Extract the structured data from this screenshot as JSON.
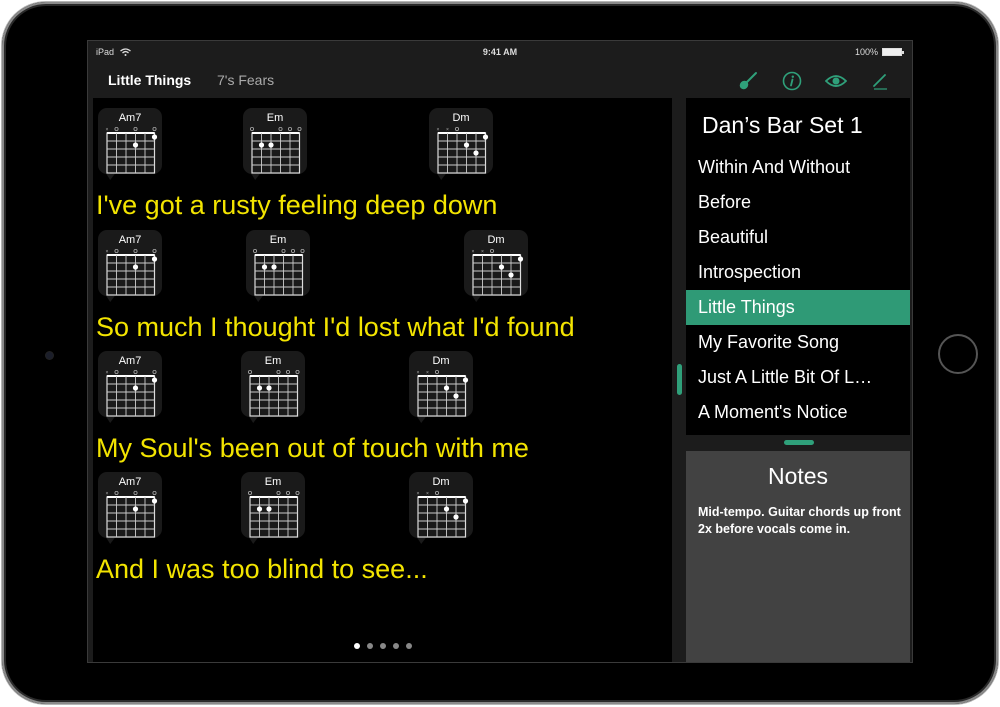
{
  "status_bar": {
    "device": "iPad",
    "time": "9:41 AM",
    "battery": "100%"
  },
  "nav": {
    "song_title": "Little Things",
    "artist": "7's Fears",
    "icons": [
      "guitar-icon",
      "info-icon",
      "eye-icon",
      "pencil-icon"
    ]
  },
  "colors": {
    "accent": "#2f9a76",
    "lyrics": "#f3e400",
    "background": "#000000"
  },
  "lines": [
    {
      "lyric": "I've got a rusty feeling deep down",
      "chords": [
        {
          "name": "Am7"
        },
        {
          "name": "Em"
        },
        {
          "name": "Dm"
        }
      ]
    },
    {
      "lyric": "So much I thought I'd lost what I'd found",
      "chords": [
        {
          "name": "Am7"
        },
        {
          "name": "Em"
        },
        {
          "name": "Dm"
        }
      ]
    },
    {
      "lyric": "My Soul's been out of touch with me",
      "chords": [
        {
          "name": "Am7"
        },
        {
          "name": "Em"
        },
        {
          "name": "Dm"
        }
      ]
    },
    {
      "lyric": "And I was too blind to see...",
      "chords": [
        {
          "name": "Am7"
        },
        {
          "name": "Em"
        },
        {
          "name": "Dm"
        }
      ]
    }
  ],
  "chord_shapes": {
    "Am7": {
      "markers": [
        "x",
        "o",
        "",
        "o",
        "",
        "o"
      ],
      "dots": [
        [
          3,
          2
        ],
        [
          5,
          1
        ]
      ]
    },
    "Em": {
      "markers": [
        "o",
        "",
        "",
        "o",
        "o",
        "o"
      ],
      "dots": [
        [
          1,
          2
        ],
        [
          2,
          2
        ]
      ]
    },
    "Dm": {
      "markers": [
        "x",
        "x",
        "o",
        "",
        "",
        ""
      ],
      "dots": [
        [
          3,
          2
        ],
        [
          4,
          3
        ],
        [
          5,
          1
        ]
      ]
    }
  },
  "pager": {
    "pages": 5,
    "current": 1
  },
  "setlist": {
    "title": "Dan’s Bar Set 1",
    "songs": [
      "Within And Without",
      "Before",
      "Beautiful",
      "Introspection",
      "Little Things",
      "My Favorite Song",
      "Just A Little Bit Of L…",
      "A Moment's Notice"
    ],
    "selected_index": 4
  },
  "notes": {
    "title": "Notes",
    "body": "Mid-tempo. Guitar chords up front 2x before vocals come in."
  }
}
